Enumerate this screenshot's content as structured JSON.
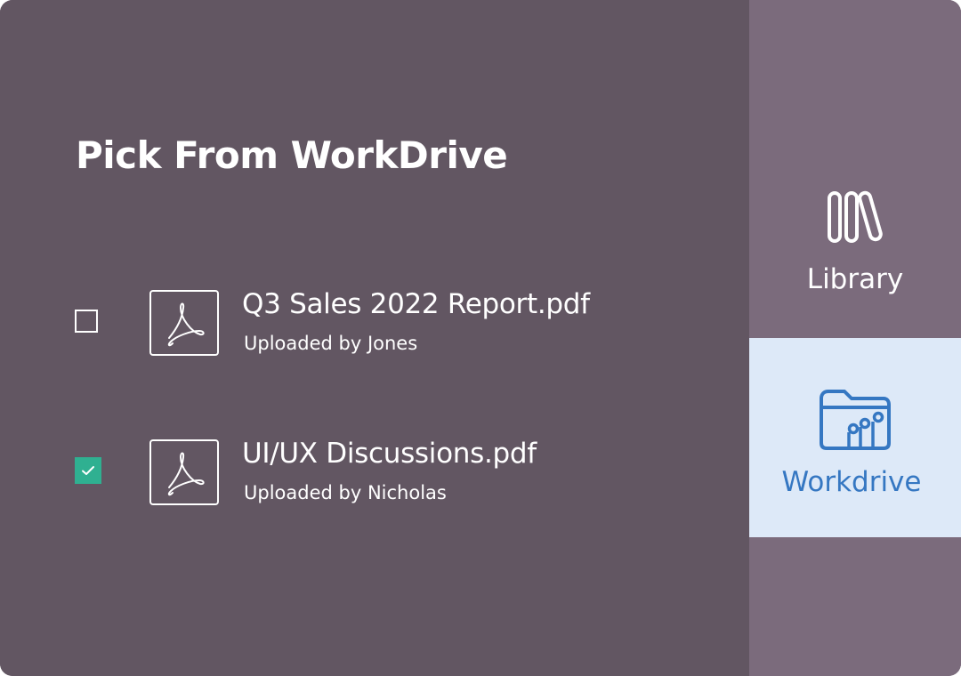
{
  "title": "Pick From WorkDrive",
  "files": [
    {
      "name": "Q3 Sales 2022 Report.pdf",
      "uploaded_by": "Uploaded by Jones",
      "checked": false,
      "icon": "pdf-icon"
    },
    {
      "name": "UI/UX Discussions.pdf",
      "uploaded_by": "Uploaded by Nicholas",
      "checked": true,
      "icon": "pdf-icon"
    }
  ],
  "sidebar": {
    "items": [
      {
        "label": "Library",
        "icon": "library-books-icon",
        "active": false
      },
      {
        "label": "Workdrive",
        "icon": "folder-chart-icon",
        "active": true
      }
    ]
  },
  "colors": {
    "main_bg": "#625662",
    "sidebar_bg": "#7b6b7c",
    "active_bg": "#dde9f8",
    "accent": "#3577c2",
    "check": "#2fb091"
  }
}
